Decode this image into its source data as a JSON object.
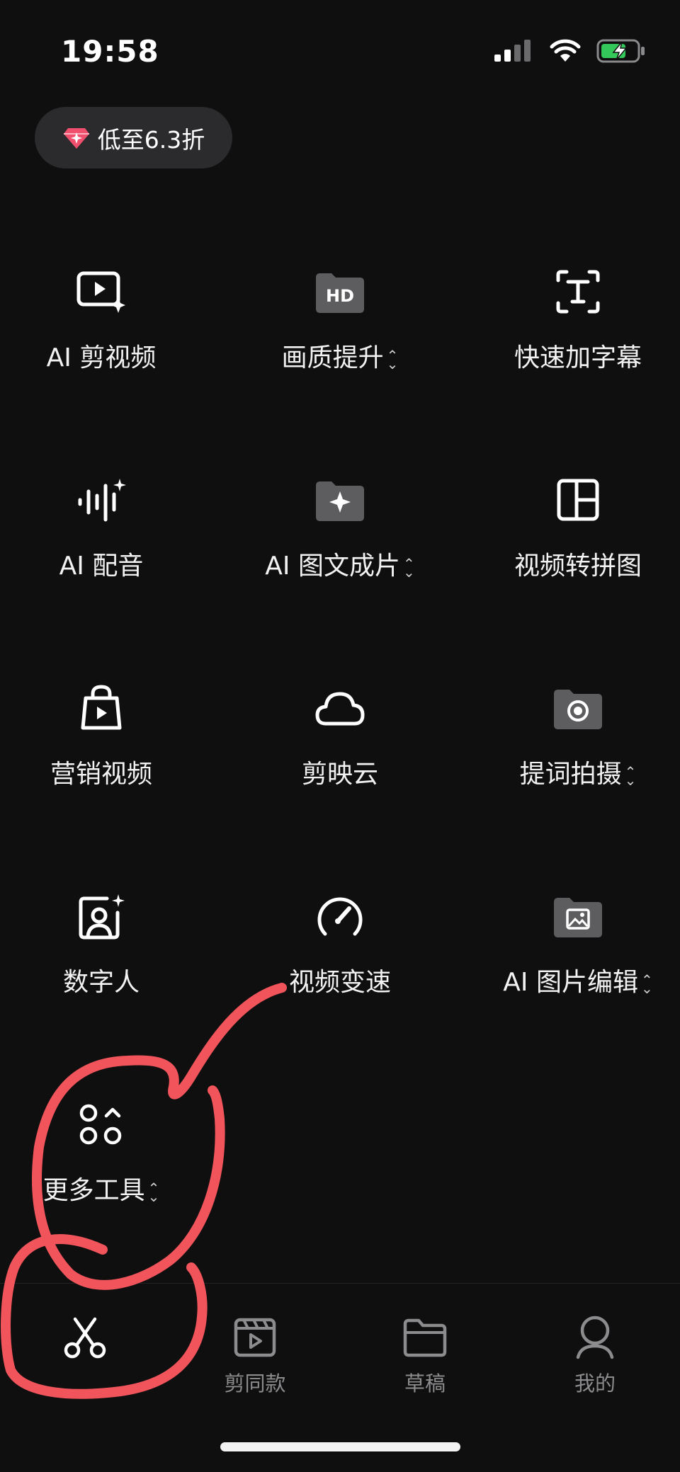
{
  "status_bar": {
    "time": "19:58"
  },
  "promo": {
    "label": "低至6.3折"
  },
  "tools": [
    {
      "label": "AI 剪视频",
      "icon": "ai-video-edit-icon",
      "chevron": false
    },
    {
      "label": "画质提升",
      "icon": "hd-quality-icon",
      "chevron": true
    },
    {
      "label": "快速加字幕",
      "icon": "subtitle-icon",
      "chevron": false
    },
    {
      "label": "AI 配音",
      "icon": "ai-voice-icon",
      "chevron": false
    },
    {
      "label": "AI 图文成片",
      "icon": "ai-image-text-icon",
      "chevron": true
    },
    {
      "label": "视频转拼图",
      "icon": "collage-icon",
      "chevron": false
    },
    {
      "label": "营销视频",
      "icon": "marketing-bag-icon",
      "chevron": false
    },
    {
      "label": "剪映云",
      "icon": "cloud-icon",
      "chevron": false
    },
    {
      "label": "提词拍摄",
      "icon": "camera-icon",
      "chevron": true
    },
    {
      "label": "数字人",
      "icon": "digital-human-icon",
      "chevron": false
    },
    {
      "label": "视频变速",
      "icon": "speedometer-icon",
      "chevron": false
    },
    {
      "label": "AI 图片编辑",
      "icon": "image-edit-icon",
      "chevron": true
    },
    {
      "label": "更多工具",
      "icon": "more-tools-icon",
      "chevron": true
    }
  ],
  "bottom_nav": [
    {
      "label": "",
      "icon": "scissors-icon",
      "active": true
    },
    {
      "label": "剪同款",
      "icon": "template-icon",
      "active": false
    },
    {
      "label": "草稿",
      "icon": "folder-icon",
      "active": false
    },
    {
      "label": "我的",
      "icon": "profile-icon",
      "active": false
    }
  ],
  "colors": {
    "background": "#0f0f10",
    "promo_bg": "#2b2b2d",
    "annotation": "#f2545b",
    "battery": "#34c759"
  }
}
